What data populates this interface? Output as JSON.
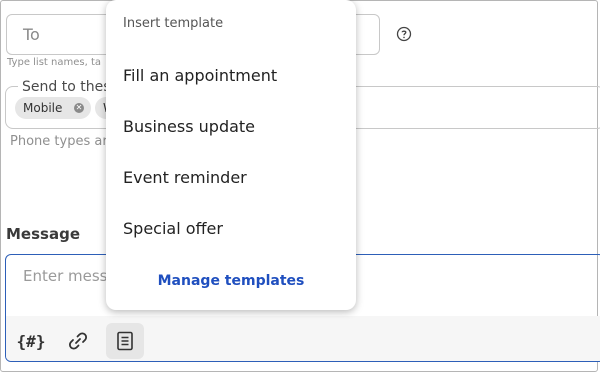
{
  "to_field": {
    "placeholder": "To",
    "hint": "Type list names, ta"
  },
  "send_to": {
    "legend": "Send to thes",
    "chips": [
      {
        "label": "Mobile"
      },
      {
        "label": "W"
      }
    ],
    "hint": "Phone types ar"
  },
  "message": {
    "label": "Message",
    "placeholder": "Enter mess"
  },
  "toolbar": {
    "variable_label": "{#}"
  },
  "template_menu": {
    "header": "Insert template",
    "items": [
      {
        "label": "Fill an appointment"
      },
      {
        "label": "Business update"
      },
      {
        "label": "Event reminder"
      },
      {
        "label": "Special offer"
      }
    ],
    "manage_label": "Manage templates"
  },
  "colors": {
    "accent": "#1f4fbf",
    "focus_border": "#2d5fb8",
    "chip_bg": "#e6e6e6"
  }
}
